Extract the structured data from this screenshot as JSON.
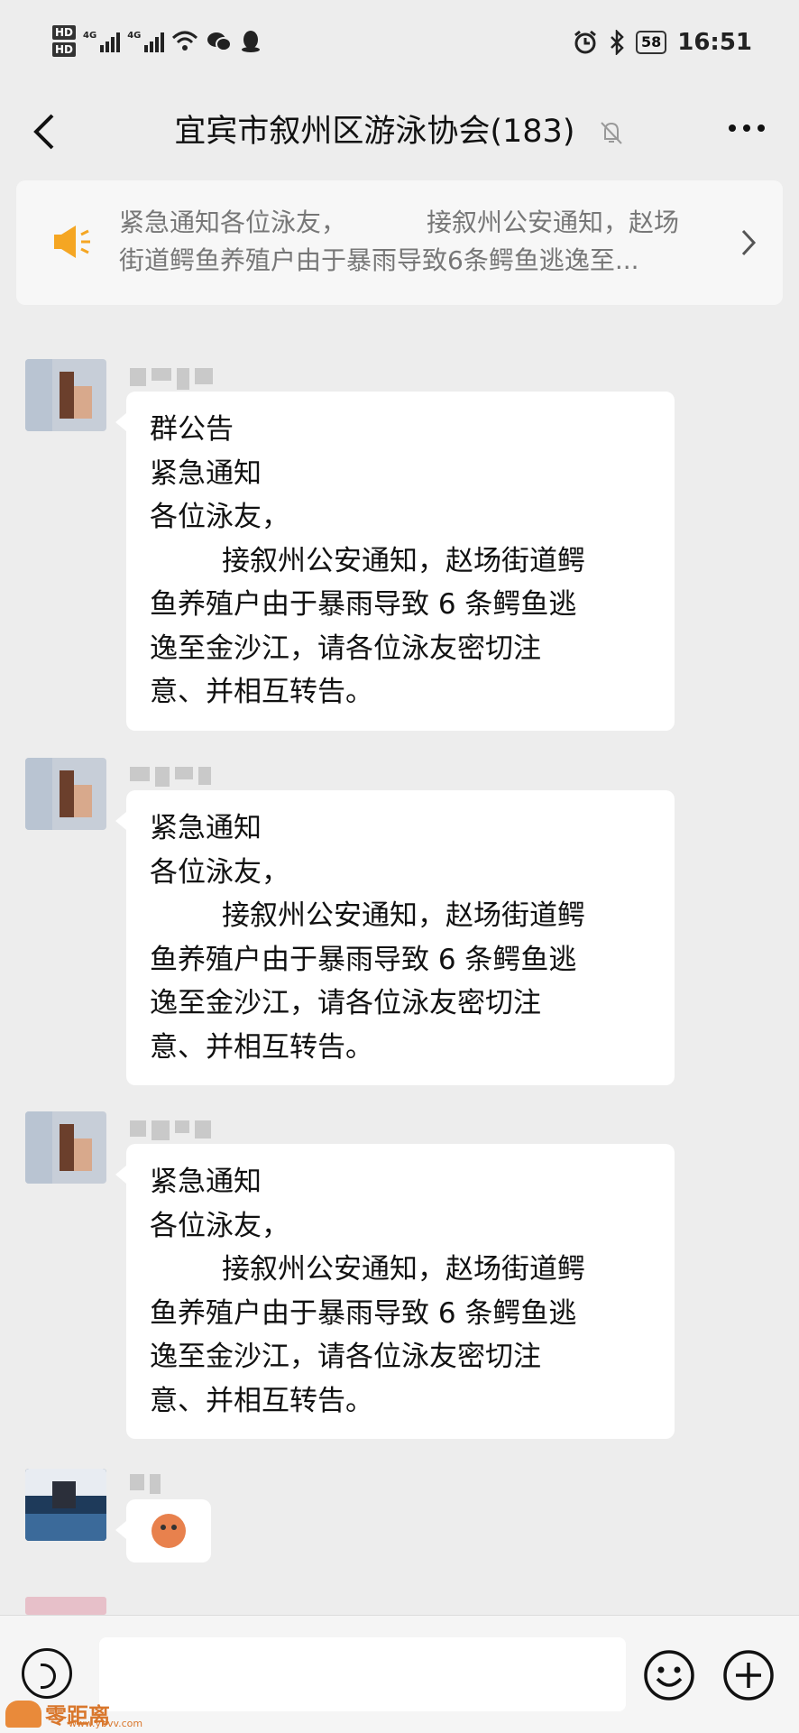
{
  "status_bar": {
    "hd_labels": [
      "HD",
      "HD"
    ],
    "network_labels": [
      "4G",
      "4G"
    ],
    "battery": "58",
    "time": "16:51"
  },
  "header": {
    "title": "宜宾市叙州区游泳协会(183)"
  },
  "announcement": {
    "line1": "紧急通知各位泳友，          接叙州公安通知，赵场",
    "line2": "街道鳄鱼养殖户由于暴雨导致6条鳄鱼逃逸至..."
  },
  "messages": [
    {
      "lines": [
        "群公告",
        "紧急通知",
        "各位泳友，",
        "接叙州公安通知，赵场街道鳄",
        "鱼养殖户由于暴雨导致 6 条鳄鱼逃",
        "逸至金沙江，请各位泳友密切注",
        "意、并相互转告。"
      ]
    },
    {
      "lines": [
        "紧急通知",
        "各位泳友，",
        "接叙州公安通知，赵场街道鳄",
        "鱼养殖户由于暴雨导致 6 条鳄鱼逃",
        "逸至金沙江，请各位泳友密切注",
        "意、并相互转告。"
      ]
    },
    {
      "lines": [
        "紧急通知",
        "各位泳友，",
        "接叙州公安通知，赵场街道鳄",
        "鱼养殖户由于暴雨导致 6 条鳄鱼逃",
        "逸至金沙江，请各位泳友密切注",
        "意、并相互转告。"
      ]
    }
  ],
  "emoji_message": {
    "icon": "worried-face-emoji"
  },
  "watermark": {
    "text": "零距离",
    "sub": "www.ybvv.com"
  },
  "colors": {
    "background": "#ededed",
    "bubble": "#ffffff",
    "megaphone": "#f5a623"
  }
}
